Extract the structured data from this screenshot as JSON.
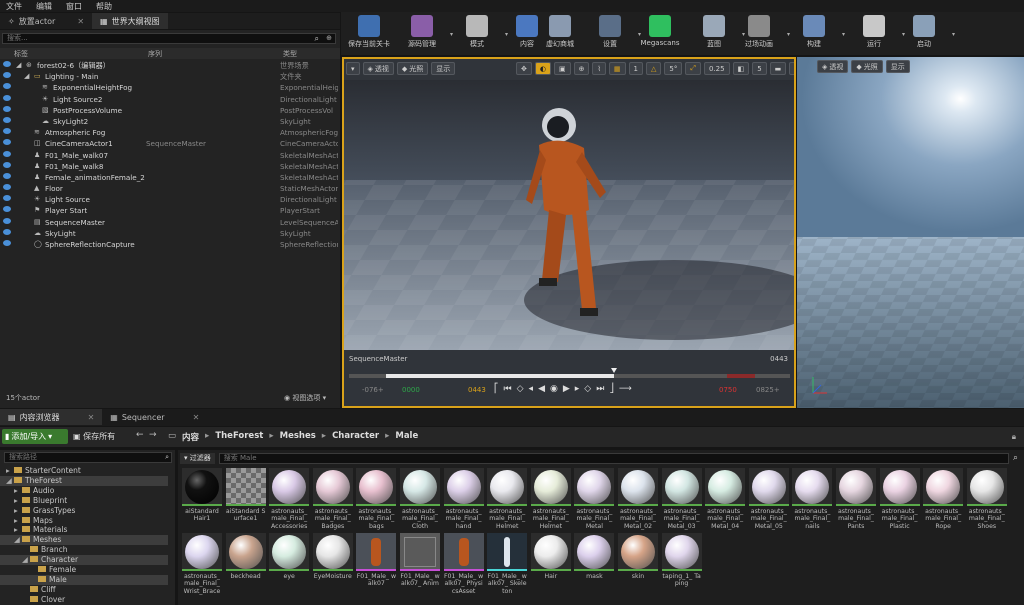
{
  "menubar": {
    "items": [
      "文件",
      "编辑",
      "窗口",
      "帮助"
    ]
  },
  "left_tabs": [
    "放置actor",
    "世界大纲视图"
  ],
  "outliner": {
    "search_placeholder": "搜索...",
    "columns": {
      "label": "标签",
      "sequence": "序列",
      "type": "类型"
    },
    "rows": [
      {
        "label": "forest02-6（编辑器）",
        "type": "世界场景",
        "seq": "",
        "indent": 0,
        "icon": "world-icon"
      },
      {
        "label": "Lighting - Main",
        "type": "文件夹",
        "seq": "",
        "indent": 1,
        "icon": "folder-icon"
      },
      {
        "label": "ExponentialHeightFog",
        "type": "ExponentialHeig",
        "seq": "",
        "indent": 2,
        "icon": "fog-icon"
      },
      {
        "label": "Light Source2",
        "type": "DirectionalLight",
        "seq": "",
        "indent": 2,
        "icon": "light-icon"
      },
      {
        "label": "PostProcessVolume",
        "type": "PostProcessVol",
        "seq": "",
        "indent": 2,
        "icon": "volume-icon"
      },
      {
        "label": "SkyLight2",
        "type": "SkyLight",
        "seq": "",
        "indent": 2,
        "icon": "skylight-icon"
      },
      {
        "label": "Atmospheric Fog",
        "type": "AtmosphericFog",
        "seq": "",
        "indent": 1,
        "icon": "fog-icon"
      },
      {
        "label": "CineCameraActor1",
        "type": "CineCameraActo",
        "seq": "SequenceMaster",
        "indent": 1,
        "icon": "camera-icon"
      },
      {
        "label": "F01_Male_walk07",
        "type": "SkeletalMeshAct",
        "seq": "",
        "indent": 1,
        "icon": "skeletal-mesh-icon"
      },
      {
        "label": "F01_Male_walk8",
        "type": "SkeletalMeshAct",
        "seq": "",
        "indent": 1,
        "icon": "skeletal-mesh-icon"
      },
      {
        "label": "Female_animationFemale_2",
        "type": "SkeletalMeshAct",
        "seq": "",
        "indent": 1,
        "icon": "skeletal-mesh-icon"
      },
      {
        "label": "Floor",
        "type": "StaticMeshActor",
        "seq": "",
        "indent": 1,
        "icon": "static-mesh-icon"
      },
      {
        "label": "Light Source",
        "type": "DirectionalLight",
        "seq": "",
        "indent": 1,
        "icon": "light-icon"
      },
      {
        "label": "Player Start",
        "type": "PlayerStart",
        "seq": "",
        "indent": 1,
        "icon": "player-start-icon"
      },
      {
        "label": "SequenceMaster",
        "type": "LevelSequenceA",
        "seq": "",
        "indent": 1,
        "icon": "sequence-icon"
      },
      {
        "label": "SkyLight",
        "type": "SkyLight",
        "seq": "",
        "indent": 1,
        "icon": "skylight-icon"
      },
      {
        "label": "SphereReflectionCapture",
        "type": "SphereReflection",
        "seq": "",
        "indent": 1,
        "icon": "reflection-icon"
      }
    ],
    "footer_count": "15个actor",
    "view_options": "视图选项"
  },
  "toolbar": {
    "buttons": [
      {
        "label": "保存当前关卡",
        "icon": "save-icon",
        "color": "#3f6fb0",
        "dropdown": false
      },
      {
        "label": "源码管理",
        "icon": "source-control-icon",
        "color": "#8a5ea8",
        "dropdown": true
      },
      {
        "label": "模式",
        "icon": "modes-icon",
        "color": "#b8b8b8",
        "dropdown": true
      },
      {
        "label": "内容",
        "icon": "content-icon",
        "color": "#4b78c0",
        "dropdown": false
      },
      {
        "label": "虚幻商城",
        "icon": "marketplace-icon",
        "color": "#8a9ab0",
        "dropdown": false
      },
      {
        "label": "设置",
        "icon": "settings-icon",
        "color": "#5a6e88",
        "dropdown": true
      },
      {
        "label": "Megascans",
        "icon": "megascans-icon",
        "color": "#2fbf5f",
        "dropdown": false
      },
      {
        "label": "蓝图",
        "icon": "blueprint-icon",
        "color": "#9aa8b8",
        "dropdown": true
      },
      {
        "label": "过场动画",
        "icon": "cinematics-icon",
        "color": "#8a8a8a",
        "dropdown": true
      },
      {
        "label": "构建",
        "icon": "build-icon",
        "color": "#6a8ab8",
        "dropdown": true
      },
      {
        "label": "运行",
        "icon": "play-icon",
        "color": "#c8c8c8",
        "dropdown": true
      },
      {
        "label": "启动",
        "icon": "launch-icon",
        "color": "#8aa0b8",
        "dropdown": true
      }
    ]
  },
  "viewport_main": {
    "perspective": "透视",
    "lit": "光照",
    "show": "显示",
    "grid_snap": "1",
    "rotation_snap": "5°",
    "scale_snap": "0.25",
    "camera_speed": "5",
    "sequence_name": "SequenceMaster",
    "current_frame": "0443",
    "timecodes": {
      "start_out": "-076+",
      "start_in": "0000",
      "current": "0443",
      "end_in": "0750",
      "end_out": "0825+"
    },
    "playhead_fraction": 0.6,
    "start_fraction": 0.085,
    "end_fraction": 0.92
  },
  "viewport_side": {
    "perspective": "透视",
    "lit": "光照",
    "show": "显示"
  },
  "bottom_tabs": [
    "内容浏览器",
    "Sequencer"
  ],
  "content_toolbar": {
    "add_import": "添加/导入",
    "save_all": "保存所有",
    "breadcrumbs": [
      "内容",
      "TheForest",
      "Meshes",
      "Character",
      "Male"
    ]
  },
  "folders": {
    "search_placeholder": "搜索路径",
    "items": [
      {
        "label": "StarterContent",
        "indent": 0,
        "selected": false
      },
      {
        "label": "TheForest",
        "indent": 0,
        "selected": true
      },
      {
        "label": "Audio",
        "indent": 1,
        "selected": false
      },
      {
        "label": "Blueprint",
        "indent": 1,
        "selected": false
      },
      {
        "label": "GrassTypes",
        "indent": 1,
        "selected": false
      },
      {
        "label": "Maps",
        "indent": 1,
        "selected": false
      },
      {
        "label": "Materials",
        "indent": 1,
        "selected": false
      },
      {
        "label": "Meshes",
        "indent": 1,
        "selected": true
      },
      {
        "label": "Branch",
        "indent": 2,
        "selected": false
      },
      {
        "label": "Character",
        "indent": 2,
        "selected": true
      },
      {
        "label": "Female",
        "indent": 3,
        "selected": false
      },
      {
        "label": "Male",
        "indent": 3,
        "selected": true
      },
      {
        "label": "Cliff",
        "indent": 2,
        "selected": false
      },
      {
        "label": "Clover",
        "indent": 2,
        "selected": false
      }
    ]
  },
  "assets": {
    "filter_label": "过滤器",
    "search_placeholder": "搜索 Male",
    "items": [
      {
        "name": "aiStandard Hair1",
        "color": "#0a0a0a",
        "kind": "sphere"
      },
      {
        "name": "aiStandard Surface1",
        "color": "#8a8a8a",
        "kind": "checker"
      },
      {
        "name": "astronauts_ male_Final_ Accessories",
        "color": "#d9c9e6",
        "kind": "sphere"
      },
      {
        "name": "astronauts_ male_Final_ Badges",
        "color": "#e6c9d6",
        "kind": "sphere"
      },
      {
        "name": "astronauts_ male_Final_ bags",
        "color": "#e8c0cf",
        "kind": "sphere"
      },
      {
        "name": "astronauts_ male_Final_ Cloth",
        "color": "#d6e8e6",
        "kind": "sphere"
      },
      {
        "name": "astronauts_ male_Final_ hand",
        "color": "#dccfe8",
        "kind": "sphere"
      },
      {
        "name": "astronauts_ male_Final_ Helmet",
        "color": "#e9e9ee",
        "kind": "sphere"
      },
      {
        "name": "astronauts_ male_Final_ Helmet",
        "color": "#e6ecd9",
        "kind": "sphere"
      },
      {
        "name": "astronauts_ male_Final_ Metal",
        "color": "#e0d6ea",
        "kind": "sphere"
      },
      {
        "name": "astronauts_ male_Final_ Metal_02",
        "color": "#dce3ec",
        "kind": "sphere"
      },
      {
        "name": "astronauts_ male_Final_ Metal_03",
        "color": "#d2e6e2",
        "kind": "sphere"
      },
      {
        "name": "astronauts_ male_Final_ Metal_04",
        "color": "#d6ece2",
        "kind": "sphere"
      },
      {
        "name": "astronauts_ male_Final_ Metal_05",
        "color": "#e0d9ec",
        "kind": "sphere"
      },
      {
        "name": "astronauts_ male_Final_ nails",
        "color": "#e6dcef",
        "kind": "sphere"
      },
      {
        "name": "astronauts_ male_Final_ Pants",
        "color": "#e6d6e0",
        "kind": "sphere"
      },
      {
        "name": "astronauts_ male_Final_ Plastic",
        "color": "#ead2e2",
        "kind": "sphere"
      },
      {
        "name": "astronauts_ male_Final_ Rope",
        "color": "#efd6e0",
        "kind": "sphere"
      },
      {
        "name": "astronauts_ male_Final_ Shoes",
        "color": "#e6e6e6",
        "kind": "sphere"
      },
      {
        "name": "astronauts_ male_Final_ Wrist_Brace",
        "color": "#dcd6ef",
        "kind": "sphere"
      },
      {
        "name": "beckhead",
        "color": "#c9a48e",
        "kind": "sphere"
      },
      {
        "name": "eye",
        "color": "#d6ece0",
        "kind": "sphere"
      },
      {
        "name": "EyeMoisture",
        "color": "#e6e6e6",
        "kind": "sphere"
      },
      {
        "name": "F01_Male_ walk07",
        "color": "#b8561f",
        "kind": "figure"
      },
      {
        "name": "F01_Male_ walk07_ Anim",
        "color": "#4a4a4a",
        "kind": "anim"
      },
      {
        "name": "F01_Male_ walk07_ PhysicsAsset",
        "color": "#b8561f",
        "kind": "figure"
      },
      {
        "name": "F01_Male_ walk07_ Skeleton",
        "color": "#dfe6ee",
        "kind": "skeleton"
      },
      {
        "name": "Hair",
        "color": "#ececec",
        "kind": "sphere"
      },
      {
        "name": "mask",
        "color": "#dcd0ec",
        "kind": "sphere"
      },
      {
        "name": "skin",
        "color": "#d6a488",
        "kind": "sphere"
      },
      {
        "name": "taping_1_ Taping",
        "color": "#e0d6ec",
        "kind": "sphere"
      }
    ]
  }
}
